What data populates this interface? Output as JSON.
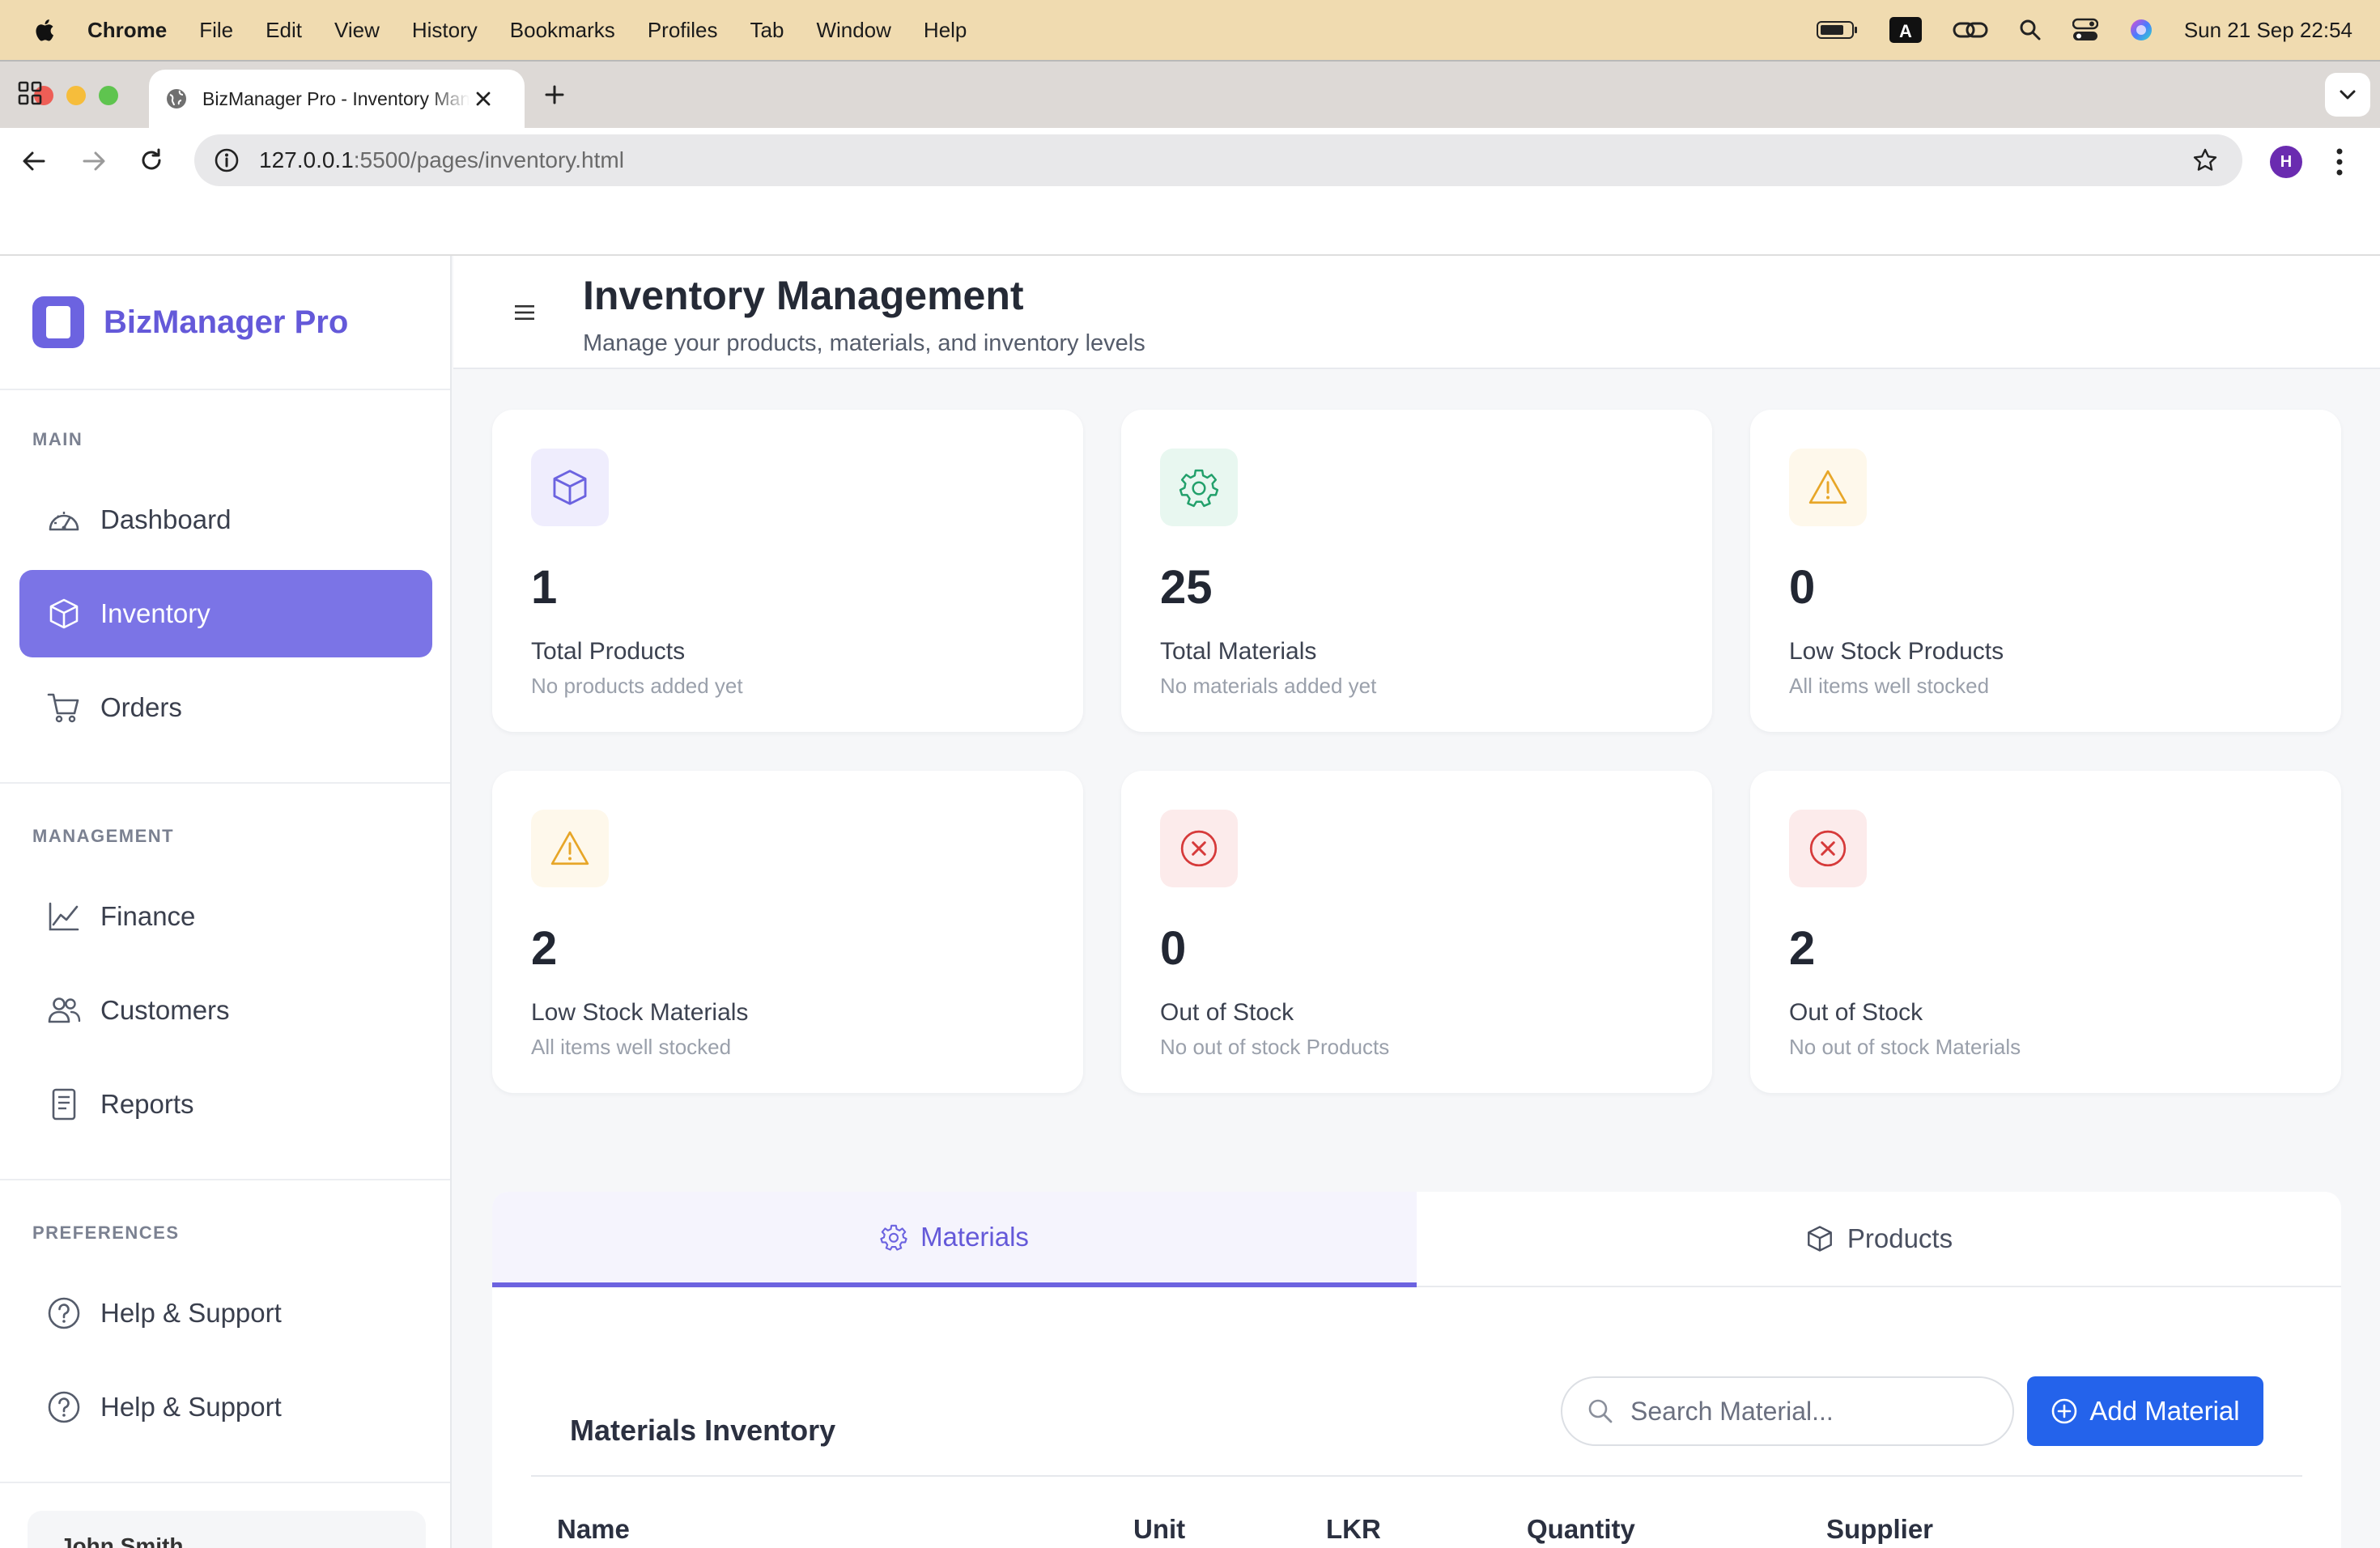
{
  "menubar": {
    "app_name": "Chrome",
    "items": [
      "File",
      "Edit",
      "View",
      "History",
      "Bookmarks",
      "Profiles",
      "Tab",
      "Window",
      "Help"
    ],
    "clock": "Sun 21 Sep  22:54"
  },
  "browser": {
    "tab_title": "BizManager Pro - Inventory Management",
    "url_host": "127.0.0.1",
    "url_path": ":5500/pages/inventory.html",
    "profile_initial": "H"
  },
  "sidebar": {
    "brand": "BizManager Pro",
    "sections": [
      {
        "title": "MAIN",
        "items": [
          {
            "label": "Dashboard",
            "icon": "dashboard-icon"
          },
          {
            "label": "Inventory",
            "icon": "box-icon",
            "active": true
          },
          {
            "label": "Orders",
            "icon": "cart-icon"
          }
        ]
      },
      {
        "title": "MANAGEMENT",
        "items": [
          {
            "label": "Finance",
            "icon": "chart-line-icon"
          },
          {
            "label": "Customers",
            "icon": "users-icon"
          },
          {
            "label": "Reports",
            "icon": "document-icon"
          }
        ]
      },
      {
        "title": "PREFERENCES",
        "items": [
          {
            "label": "Help & Support",
            "icon": "question-icon"
          },
          {
            "label": "Help & Support",
            "icon": "question-icon"
          }
        ]
      }
    ],
    "user_name": "John Smith"
  },
  "header": {
    "title": "Inventory Management",
    "subtitle": "Manage your products, materials, and inventory levels"
  },
  "stats": [
    {
      "value": "1",
      "label": "Total Products",
      "sub": "No products added yet",
      "icon": "box-icon",
      "tone": "purple"
    },
    {
      "value": "25",
      "label": "Total Materials",
      "sub": "No materials added yet",
      "icon": "gear-icon",
      "tone": "green"
    },
    {
      "value": "0",
      "label": "Low Stock Products",
      "sub": "All items well stocked",
      "icon": "warning-icon",
      "tone": "amber"
    },
    {
      "value": "2",
      "label": "Low Stock Materials",
      "sub": "All items well stocked",
      "icon": "warning-icon",
      "tone": "amber"
    },
    {
      "value": "0",
      "label": "Out of Stock",
      "sub": "No out of stock Products",
      "icon": "x-circle-icon",
      "tone": "red"
    },
    {
      "value": "2",
      "label": "Out of Stock",
      "sub": "No out of stock Materials",
      "icon": "x-circle-icon",
      "tone": "red"
    }
  ],
  "tabs": [
    {
      "label": "Materials",
      "icon": "gear-icon",
      "active": true
    },
    {
      "label": "Products",
      "icon": "box-icon",
      "active": false
    }
  ],
  "materials": {
    "title": "Materials Inventory",
    "search_placeholder": "Search Material...",
    "add_button": "Add Material",
    "columns": [
      "Name",
      "Unit",
      "LKR",
      "Quantity",
      "Supplier"
    ]
  },
  "colors": {
    "accent": "#6c63e0",
    "active_nav": "#7b74e6",
    "primary_button": "#2463eb",
    "menubar": "#f0dbb0"
  }
}
